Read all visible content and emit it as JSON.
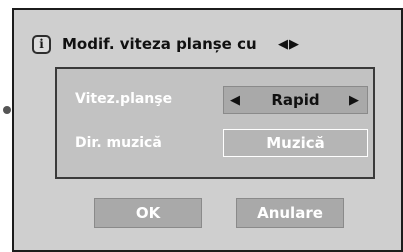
{
  "dialog": {
    "title": "Modif. viteza planșe cu",
    "title_icon": "info-icon",
    "title_icon_glyph": "i",
    "title_arrows": "◀▶"
  },
  "settings": {
    "speed_label": "Vitez.planşe",
    "speed_value": "Rapid",
    "speed_prev_arrow": "◀",
    "speed_next_arrow": "▶",
    "music_label": "Dir. muzică",
    "music_value": "Muzică"
  },
  "buttons": {
    "ok_label": "OK",
    "cancel_label": "Anulare"
  },
  "colors": {
    "dialog_background": "#cfcfcf",
    "panel_background": "#c2c2c2",
    "button_background": "#a9a9a9",
    "text_dark": "#111111",
    "text_light": "#ffffff"
  }
}
